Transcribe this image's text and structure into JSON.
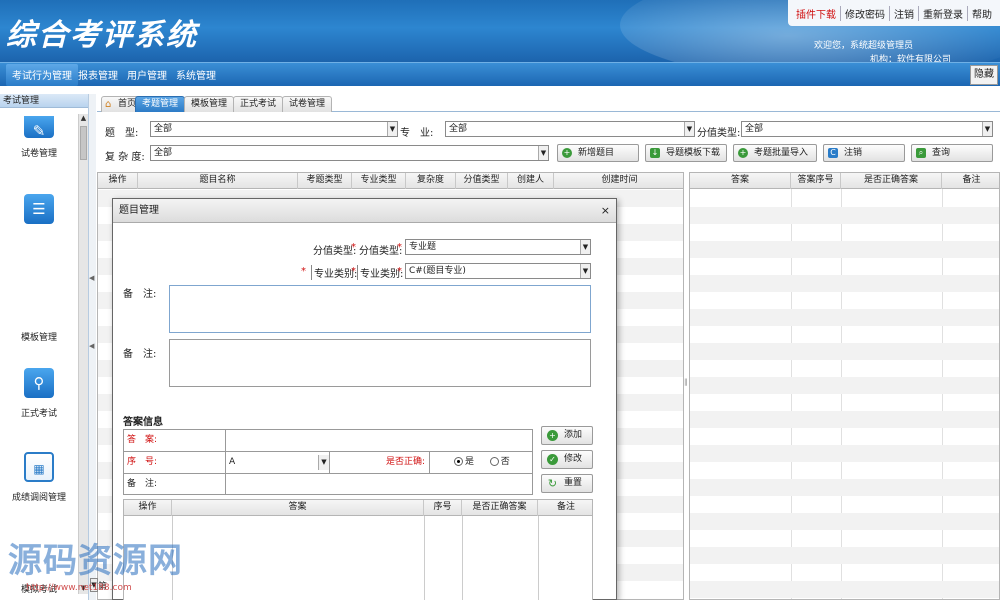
{
  "header": {
    "title": "综合考评系统",
    "links": [
      "插件下载",
      "修改密码",
      "注销",
      "重新登录",
      "帮助"
    ],
    "welcome": "欢迎您，系统超级管理员",
    "org": "机构：软件有限公司"
  },
  "nav": {
    "items": [
      "考试行为管理",
      "报表管理",
      "用户管理",
      "系统管理"
    ],
    "hide_label": "隐藏"
  },
  "sidebar": {
    "header": "考试管理",
    "items": [
      {
        "label": "试卷管理",
        "icon": "pencil-icon"
      },
      {
        "label": "模板管理",
        "icon": "list-icon"
      },
      {
        "label": "正式考试",
        "icon": "person-icon"
      },
      {
        "label": "成绩调阅管理",
        "icon": "grade-icon"
      },
      {
        "label": "模拟考试",
        "icon": "exam-icon"
      }
    ]
  },
  "tabs": [
    "首页",
    "考题管理",
    "模板管理",
    "正式考试",
    "试卷管理"
  ],
  "search": {
    "type_label": "题　型:",
    "type_value": "全部",
    "major_label": "专　业:",
    "major_value": "全部",
    "score_label": "分值类型:",
    "score_value": "全部",
    "complex_label": "复 杂 度:",
    "complex_value": "全部",
    "buttons": [
      "新增题目",
      "导题模板下载",
      "考题批量导入",
      "注销",
      "查询"
    ]
  },
  "left_grid": {
    "columns": [
      "操作",
      "题目名称",
      "考题类型",
      "专业类型",
      "复杂度",
      "分值类型",
      "创建人",
      "创建时间"
    ]
  },
  "right_grid": {
    "columns": [
      "答案",
      "答案序号",
      "是否正确答案",
      "备注"
    ]
  },
  "modal": {
    "title": "题目管理",
    "close": "×",
    "score_label1": "分值类型:",
    "score_label2": "分值类型:",
    "score_value": "专业题",
    "major_label1": "专业类别:",
    "major_label2": "专业类别:",
    "major_value": "C#(题目专业)",
    "remark_label": "备　注:",
    "remark_label2": "备　注:",
    "answer_section": "答案信息",
    "answer_label": "答　案:",
    "seq_label": "序　号:",
    "seq_value": "A",
    "correct_label": "是否正确:",
    "yes": "是",
    "no": "否",
    "note_label": "备　注:",
    "buttons": [
      "添加",
      "修改",
      "重置"
    ],
    "grid_columns": [
      "操作",
      "答案",
      "序号",
      "是否正确答案",
      "备注"
    ]
  },
  "page_indicator": "第",
  "watermark": "源码资源网",
  "watermark_url": "http://www.net188.com"
}
